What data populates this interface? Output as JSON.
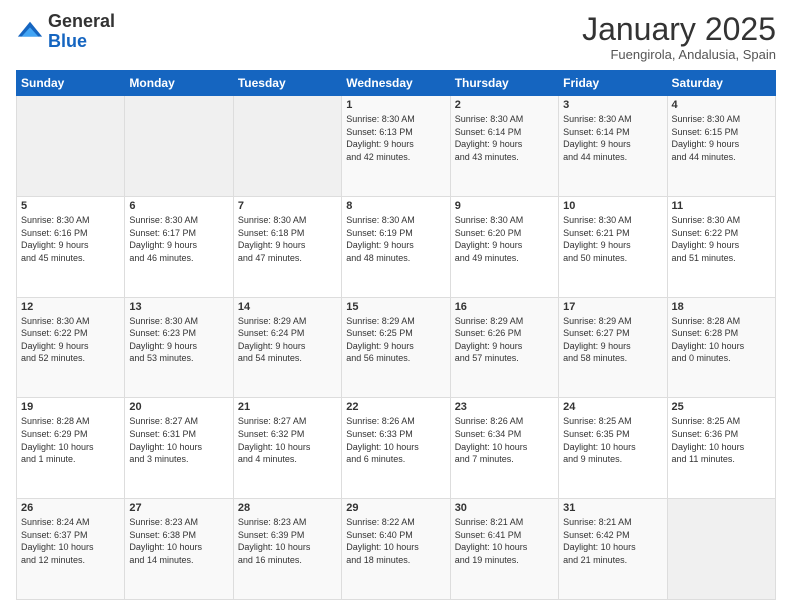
{
  "header": {
    "logo_general": "General",
    "logo_blue": "Blue",
    "month_title": "January 2025",
    "subtitle": "Fuengirola, Andalusia, Spain"
  },
  "weekdays": [
    "Sunday",
    "Monday",
    "Tuesday",
    "Wednesday",
    "Thursday",
    "Friday",
    "Saturday"
  ],
  "weeks": [
    [
      {
        "day": "",
        "info": ""
      },
      {
        "day": "",
        "info": ""
      },
      {
        "day": "",
        "info": ""
      },
      {
        "day": "1",
        "info": "Sunrise: 8:30 AM\nSunset: 6:13 PM\nDaylight: 9 hours\nand 42 minutes."
      },
      {
        "day": "2",
        "info": "Sunrise: 8:30 AM\nSunset: 6:14 PM\nDaylight: 9 hours\nand 43 minutes."
      },
      {
        "day": "3",
        "info": "Sunrise: 8:30 AM\nSunset: 6:14 PM\nDaylight: 9 hours\nand 44 minutes."
      },
      {
        "day": "4",
        "info": "Sunrise: 8:30 AM\nSunset: 6:15 PM\nDaylight: 9 hours\nand 44 minutes."
      }
    ],
    [
      {
        "day": "5",
        "info": "Sunrise: 8:30 AM\nSunset: 6:16 PM\nDaylight: 9 hours\nand 45 minutes."
      },
      {
        "day": "6",
        "info": "Sunrise: 8:30 AM\nSunset: 6:17 PM\nDaylight: 9 hours\nand 46 minutes."
      },
      {
        "day": "7",
        "info": "Sunrise: 8:30 AM\nSunset: 6:18 PM\nDaylight: 9 hours\nand 47 minutes."
      },
      {
        "day": "8",
        "info": "Sunrise: 8:30 AM\nSunset: 6:19 PM\nDaylight: 9 hours\nand 48 minutes."
      },
      {
        "day": "9",
        "info": "Sunrise: 8:30 AM\nSunset: 6:20 PM\nDaylight: 9 hours\nand 49 minutes."
      },
      {
        "day": "10",
        "info": "Sunrise: 8:30 AM\nSunset: 6:21 PM\nDaylight: 9 hours\nand 50 minutes."
      },
      {
        "day": "11",
        "info": "Sunrise: 8:30 AM\nSunset: 6:22 PM\nDaylight: 9 hours\nand 51 minutes."
      }
    ],
    [
      {
        "day": "12",
        "info": "Sunrise: 8:30 AM\nSunset: 6:22 PM\nDaylight: 9 hours\nand 52 minutes."
      },
      {
        "day": "13",
        "info": "Sunrise: 8:30 AM\nSunset: 6:23 PM\nDaylight: 9 hours\nand 53 minutes."
      },
      {
        "day": "14",
        "info": "Sunrise: 8:29 AM\nSunset: 6:24 PM\nDaylight: 9 hours\nand 54 minutes."
      },
      {
        "day": "15",
        "info": "Sunrise: 8:29 AM\nSunset: 6:25 PM\nDaylight: 9 hours\nand 56 minutes."
      },
      {
        "day": "16",
        "info": "Sunrise: 8:29 AM\nSunset: 6:26 PM\nDaylight: 9 hours\nand 57 minutes."
      },
      {
        "day": "17",
        "info": "Sunrise: 8:29 AM\nSunset: 6:27 PM\nDaylight: 9 hours\nand 58 minutes."
      },
      {
        "day": "18",
        "info": "Sunrise: 8:28 AM\nSunset: 6:28 PM\nDaylight: 10 hours\nand 0 minutes."
      }
    ],
    [
      {
        "day": "19",
        "info": "Sunrise: 8:28 AM\nSunset: 6:29 PM\nDaylight: 10 hours\nand 1 minute."
      },
      {
        "day": "20",
        "info": "Sunrise: 8:27 AM\nSunset: 6:31 PM\nDaylight: 10 hours\nand 3 minutes."
      },
      {
        "day": "21",
        "info": "Sunrise: 8:27 AM\nSunset: 6:32 PM\nDaylight: 10 hours\nand 4 minutes."
      },
      {
        "day": "22",
        "info": "Sunrise: 8:26 AM\nSunset: 6:33 PM\nDaylight: 10 hours\nand 6 minutes."
      },
      {
        "day": "23",
        "info": "Sunrise: 8:26 AM\nSunset: 6:34 PM\nDaylight: 10 hours\nand 7 minutes."
      },
      {
        "day": "24",
        "info": "Sunrise: 8:25 AM\nSunset: 6:35 PM\nDaylight: 10 hours\nand 9 minutes."
      },
      {
        "day": "25",
        "info": "Sunrise: 8:25 AM\nSunset: 6:36 PM\nDaylight: 10 hours\nand 11 minutes."
      }
    ],
    [
      {
        "day": "26",
        "info": "Sunrise: 8:24 AM\nSunset: 6:37 PM\nDaylight: 10 hours\nand 12 minutes."
      },
      {
        "day": "27",
        "info": "Sunrise: 8:23 AM\nSunset: 6:38 PM\nDaylight: 10 hours\nand 14 minutes."
      },
      {
        "day": "28",
        "info": "Sunrise: 8:23 AM\nSunset: 6:39 PM\nDaylight: 10 hours\nand 16 minutes."
      },
      {
        "day": "29",
        "info": "Sunrise: 8:22 AM\nSunset: 6:40 PM\nDaylight: 10 hours\nand 18 minutes."
      },
      {
        "day": "30",
        "info": "Sunrise: 8:21 AM\nSunset: 6:41 PM\nDaylight: 10 hours\nand 19 minutes."
      },
      {
        "day": "31",
        "info": "Sunrise: 8:21 AM\nSunset: 6:42 PM\nDaylight: 10 hours\nand 21 minutes."
      },
      {
        "day": "",
        "info": ""
      }
    ]
  ]
}
